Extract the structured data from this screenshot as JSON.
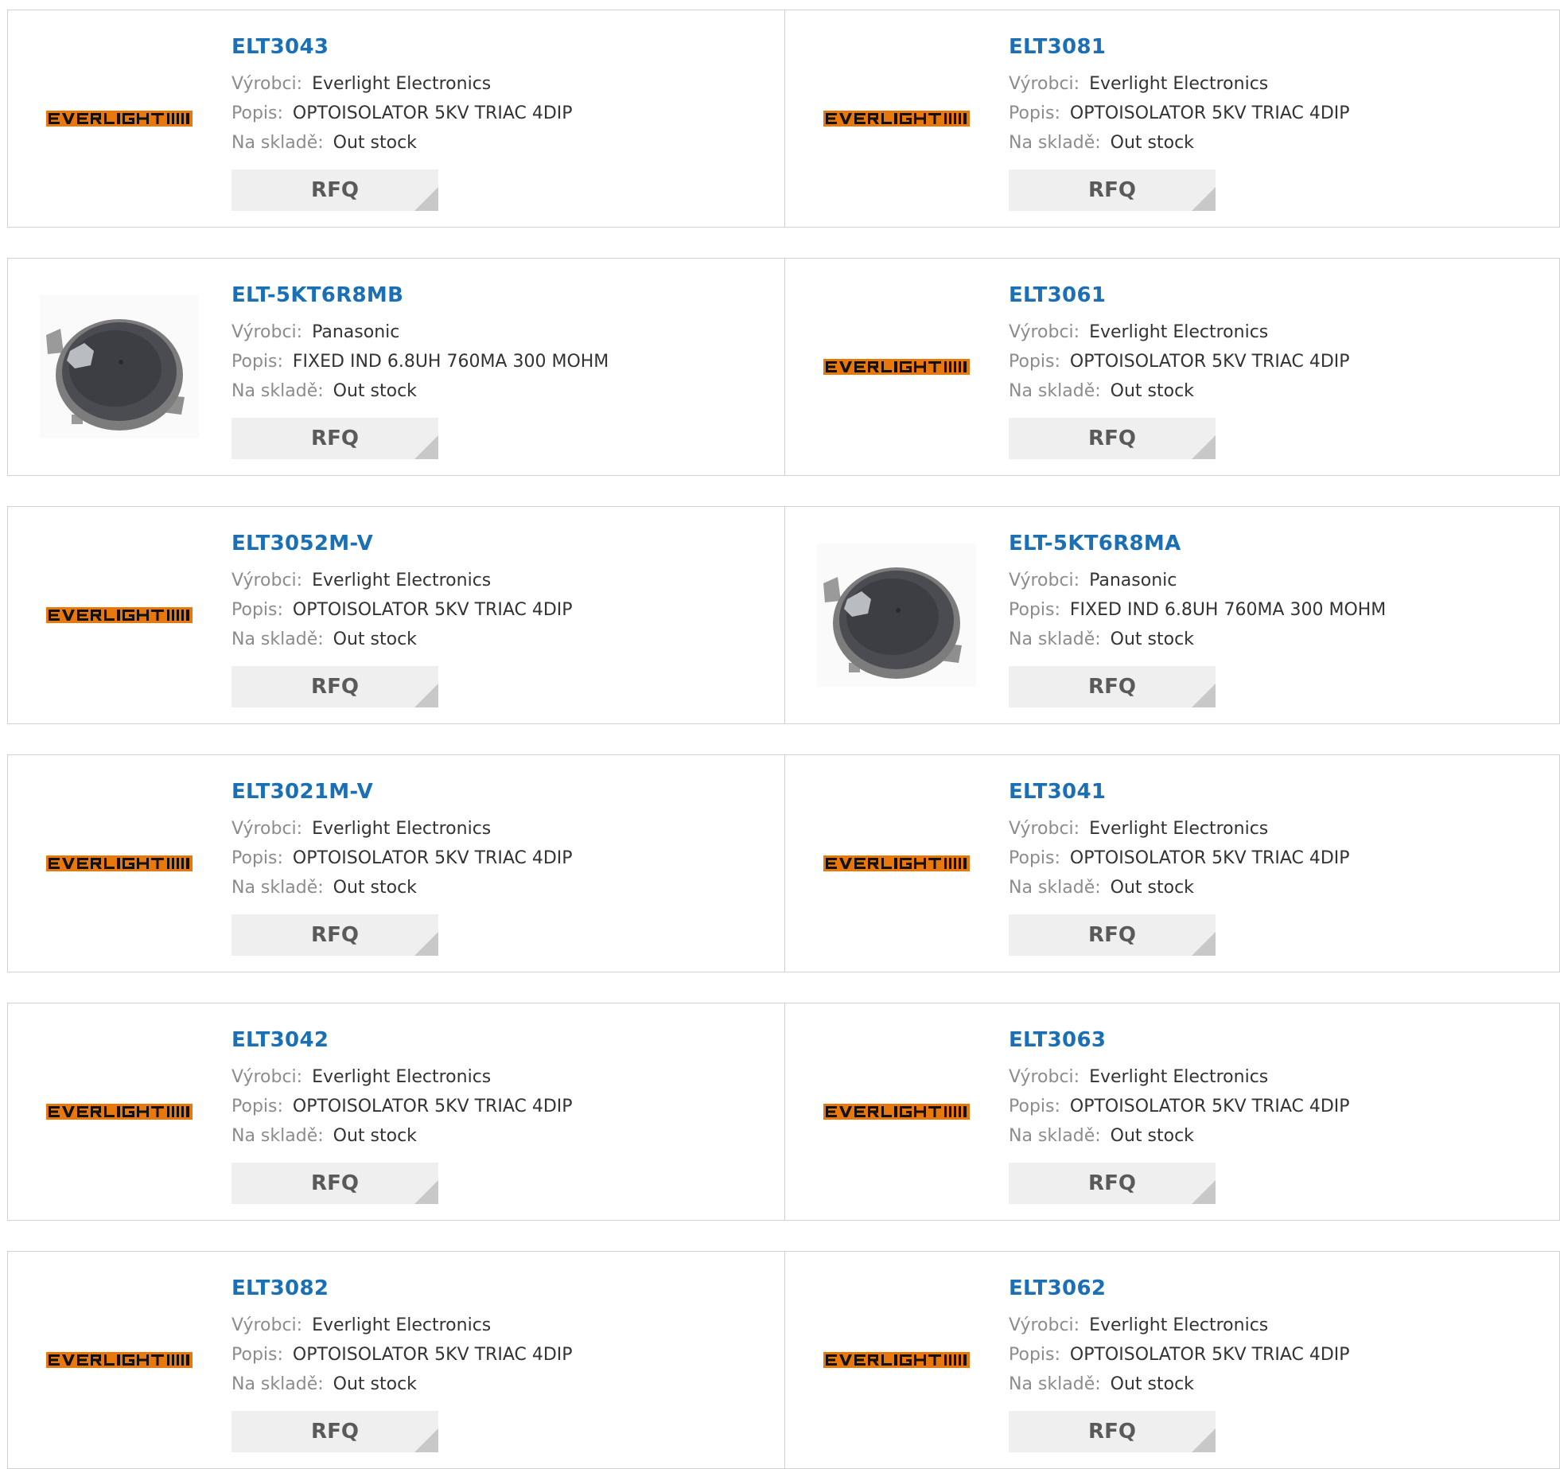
{
  "colors": {
    "link": "#1a6fb5",
    "label": "#8c8c8c",
    "value": "#333333",
    "button_bg": "#efefef",
    "logo_orange": "#e8780c"
  },
  "labels": {
    "manufacturer": "Výrobci:",
    "description": "Popis:",
    "stock": "Na skladě:",
    "rfq": "RFQ"
  },
  "products": [
    {
      "part": "ELT3043",
      "manufacturer": "Everlight Electronics",
      "description": "OPTOISOLATOR 5KV TRIAC 4DIP",
      "stock": "Out stock",
      "image": "everlight-logo"
    },
    {
      "part": "ELT3081",
      "manufacturer": "Everlight Electronics",
      "description": "OPTOISOLATOR 5KV TRIAC 4DIP",
      "stock": "Out stock",
      "image": "everlight-logo"
    },
    {
      "part": "ELT-5KT6R8MB",
      "manufacturer": "Panasonic",
      "description": "FIXED IND 6.8UH 760MA 300 MOHM",
      "stock": "Out stock",
      "image": "inductor-photo"
    },
    {
      "part": "ELT3061",
      "manufacturer": "Everlight Electronics",
      "description": "OPTOISOLATOR 5KV TRIAC 4DIP",
      "stock": "Out stock",
      "image": "everlight-logo"
    },
    {
      "part": "ELT3052M-V",
      "manufacturer": "Everlight Electronics",
      "description": "OPTOISOLATOR 5KV TRIAC 4DIP",
      "stock": "Out stock",
      "image": "everlight-logo"
    },
    {
      "part": "ELT-5KT6R8MA",
      "manufacturer": "Panasonic",
      "description": "FIXED IND 6.8UH 760MA 300 MOHM",
      "stock": "Out stock",
      "image": "inductor-photo"
    },
    {
      "part": "ELT3021M-V",
      "manufacturer": "Everlight Electronics",
      "description": "OPTOISOLATOR 5KV TRIAC 4DIP",
      "stock": "Out stock",
      "image": "everlight-logo"
    },
    {
      "part": "ELT3041",
      "manufacturer": "Everlight Electronics",
      "description": "OPTOISOLATOR 5KV TRIAC 4DIP",
      "stock": "Out stock",
      "image": "everlight-logo"
    },
    {
      "part": "ELT3042",
      "manufacturer": "Everlight Electronics",
      "description": "OPTOISOLATOR 5KV TRIAC 4DIP",
      "stock": "Out stock",
      "image": "everlight-logo"
    },
    {
      "part": "ELT3063",
      "manufacturer": "Everlight Electronics",
      "description": "OPTOISOLATOR 5KV TRIAC 4DIP",
      "stock": "Out stock",
      "image": "everlight-logo"
    },
    {
      "part": "ELT3082",
      "manufacturer": "Everlight Electronics",
      "description": "OPTOISOLATOR 5KV TRIAC 4DIP",
      "stock": "Out stock",
      "image": "everlight-logo"
    },
    {
      "part": "ELT3062",
      "manufacturer": "Everlight Electronics",
      "description": "OPTOISOLATOR 5KV TRIAC 4DIP",
      "stock": "Out stock",
      "image": "everlight-logo"
    }
  ]
}
